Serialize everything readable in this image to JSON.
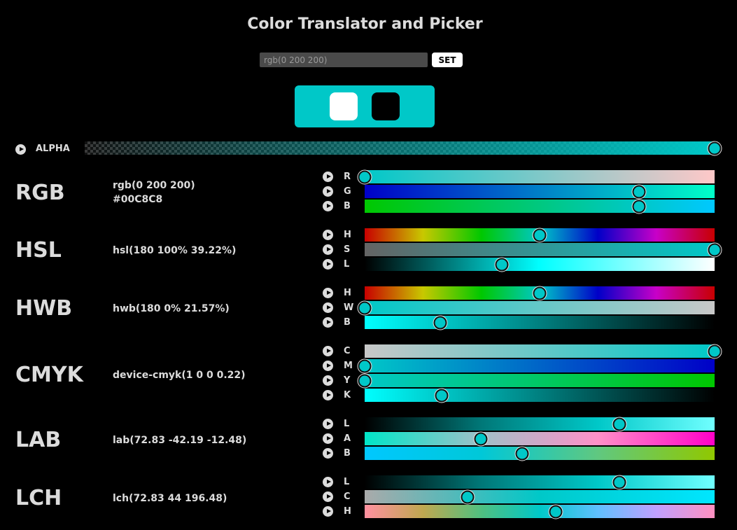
{
  "title": "Color Translator and Picker",
  "input": {
    "placeholder": "rgb(0 200 200)",
    "value": ""
  },
  "set_label": "SET",
  "colors": {
    "current": "#00C8C8",
    "white": "#FFFFFF",
    "black": "#000000"
  },
  "alpha": {
    "label": "ALPHA",
    "value": 1.0
  },
  "models": [
    {
      "name": "RGB",
      "values": [
        "rgb(0 200 200)",
        "#00C8C8"
      ],
      "channels": [
        {
          "label": "R",
          "value": 0,
          "min": 0,
          "max": 255,
          "gradient": "linear-gradient(90deg,#00c8c8,#ffc8c8)"
        },
        {
          "label": "G",
          "value": 200,
          "min": 0,
          "max": 255,
          "gradient": "linear-gradient(90deg,#0000c8,#00ffc8)"
        },
        {
          "label": "B",
          "value": 200,
          "min": 0,
          "max": 255,
          "gradient": "linear-gradient(90deg,#00c800,#00c8ff)"
        }
      ]
    },
    {
      "name": "HSL",
      "values": [
        "hsl(180 100% 39.22%)"
      ],
      "channels": [
        {
          "label": "H",
          "value": 180,
          "min": 0,
          "max": 360,
          "gradient": "linear-gradient(90deg,#c80000,#c8c800,#00c800,#00c8c8,#0000c8,#c800c8,#c80000)"
        },
        {
          "label": "S",
          "value": 100,
          "min": 0,
          "max": 100,
          "gradient": "linear-gradient(90deg,#646464,#00c8c8)"
        },
        {
          "label": "L",
          "value": 39.22,
          "min": 0,
          "max": 100,
          "gradient": "linear-gradient(90deg,#000000,#00ffff,#ffffff)"
        }
      ]
    },
    {
      "name": "HWB",
      "values": [
        "hwb(180 0% 21.57%)"
      ],
      "channels": [
        {
          "label": "H",
          "value": 180,
          "min": 0,
          "max": 360,
          "gradient": "linear-gradient(90deg,#c80000,#c8c800,#00c800,#00c8c8,#0000c8,#c800c8,#c80000)"
        },
        {
          "label": "W",
          "value": 0,
          "min": 0,
          "max": 100,
          "gradient": "linear-gradient(90deg,#00c8c8,#c8c8c8)"
        },
        {
          "label": "B",
          "value": 21.57,
          "min": 0,
          "max": 100,
          "gradient": "linear-gradient(90deg,#00ffff,#000000)"
        }
      ]
    },
    {
      "name": "CMYK",
      "values": [
        "device-cmyk(1 0 0 0.22)"
      ],
      "channels": [
        {
          "label": "C",
          "value": 1,
          "min": 0,
          "max": 1,
          "gradient": "linear-gradient(90deg,#c8c8c8,#00c8c8)"
        },
        {
          "label": "M",
          "value": 0,
          "min": 0,
          "max": 1,
          "gradient": "linear-gradient(90deg,#00c8c8,#0000c8)"
        },
        {
          "label": "Y",
          "value": 0,
          "min": 0,
          "max": 1,
          "gradient": "linear-gradient(90deg,#00c8c8,#00c800)"
        },
        {
          "label": "K",
          "value": 0.22,
          "min": 0,
          "max": 1,
          "gradient": "linear-gradient(90deg,#00ffff,#000000)"
        }
      ]
    },
    {
      "name": "LAB",
      "values": [
        "lab(72.83 -42.19 -12.48)"
      ],
      "channels": [
        {
          "label": "L",
          "value": 72.83,
          "min": 0,
          "max": 100,
          "gradient": "linear-gradient(90deg,#000000,#007878,#00c8c8,#70ffff)"
        },
        {
          "label": "A",
          "value": -42.19,
          "min": -125,
          "max": 125,
          "gradient": "linear-gradient(90deg,#00e6c8,#a0c0c8,#ff90c8,#ff00c8)"
        },
        {
          "label": "B",
          "value": -12.48,
          "min": -125,
          "max": 125,
          "gradient": "linear-gradient(90deg,#00c8ff,#00c8d8,#60c880,#90c800)"
        }
      ]
    },
    {
      "name": "LCH",
      "values": [
        "lch(72.83 44 196.48)"
      ],
      "channels": [
        {
          "label": "L",
          "value": 72.83,
          "min": 0,
          "max": 100,
          "gradient": "linear-gradient(90deg,#000000,#007878,#00c8c8,#70ffff)"
        },
        {
          "label": "C",
          "value": 44,
          "min": 0,
          "max": 150,
          "gradient": "linear-gradient(90deg,#aaaaaa,#00c8c8,#00e6ff)"
        },
        {
          "label": "H",
          "value": 196.48,
          "min": 0,
          "max": 360,
          "gradient": "linear-gradient(90deg,#ff90a0,#c0a850,#50c080,#00c8c8,#60c0ff,#c0a0ff,#ff90c0)"
        }
      ]
    }
  ]
}
